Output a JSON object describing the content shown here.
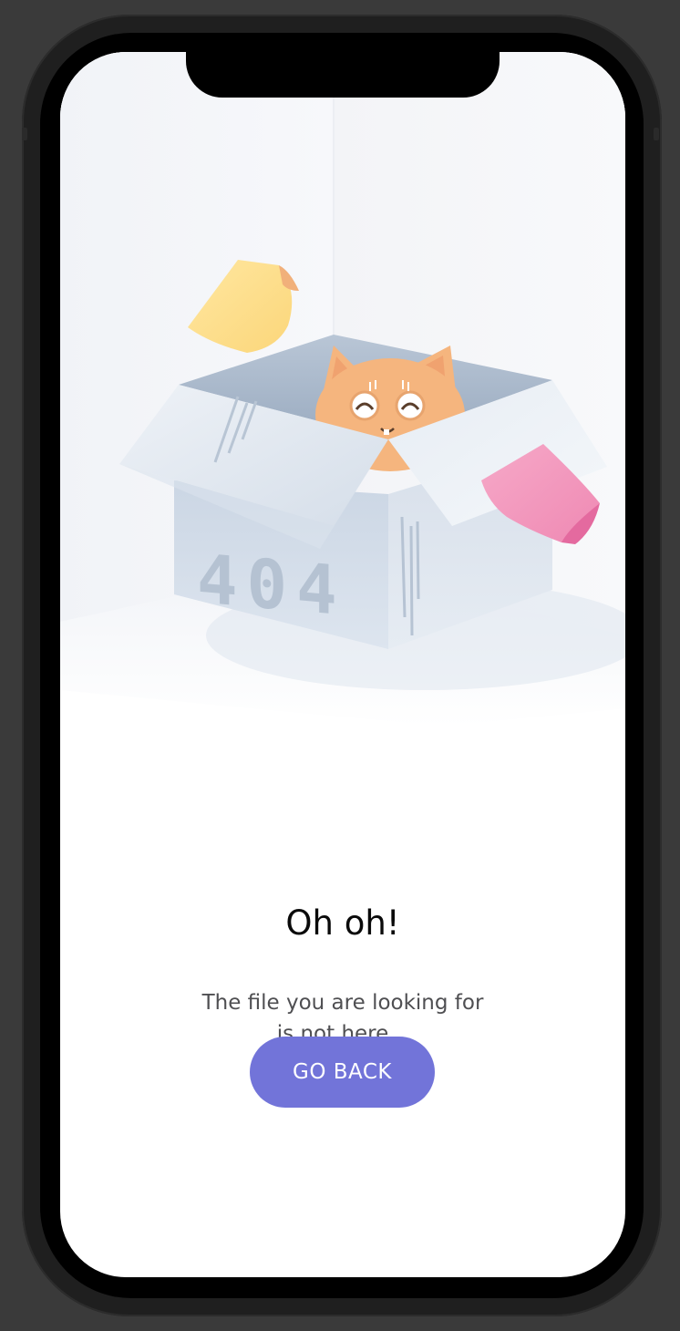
{
  "error": {
    "box_label": "404",
    "title": "Oh oh!",
    "message": "The file you are looking for is not here...",
    "button_label": "GO BACK"
  },
  "colors": {
    "accent": "#7274d9",
    "title_text": "#0a0a0a",
    "body_text": "#4f4f52",
    "note_yellow": "#ffe08a",
    "note_pink": "#f29bc0",
    "cat": "#f5b57e"
  },
  "icons": [
    "cat-illustration",
    "box-illustration",
    "sticky-note-yellow",
    "sticky-note-pink"
  ]
}
